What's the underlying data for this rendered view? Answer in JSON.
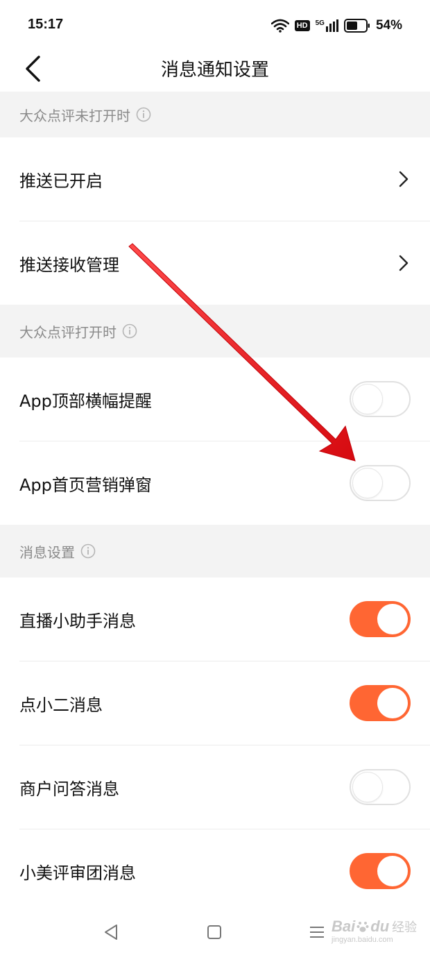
{
  "status_bar": {
    "time": "15:17",
    "network_badge": "HD",
    "network_type": "5G",
    "battery_percent": "54%"
  },
  "nav": {
    "title": "消息通知设置",
    "back_icon": "chevron-left-icon"
  },
  "sections": [
    {
      "header": "大众点评未打开时",
      "items": [
        {
          "label": "推送已开启",
          "control": "chevron"
        },
        {
          "label": "推送接收管理",
          "control": "chevron"
        }
      ]
    },
    {
      "header": "大众点评打开时",
      "items": [
        {
          "label": "App顶部横幅提醒",
          "control": "toggle",
          "enabled": false
        },
        {
          "label": "App首页营销弹窗",
          "control": "toggle",
          "enabled": false
        }
      ]
    },
    {
      "header": "消息设置",
      "items": [
        {
          "label": "直播小助手消息",
          "control": "toggle",
          "enabled": true
        },
        {
          "label": "点小二消息",
          "control": "toggle",
          "enabled": true
        },
        {
          "label": "商户问答消息",
          "control": "toggle",
          "enabled": false
        },
        {
          "label": "小美评审团消息",
          "control": "toggle",
          "enabled": true
        }
      ]
    }
  ],
  "watermark": {
    "brand": "Bai",
    "brand_suffix": "du",
    "label": "经验",
    "url": "jingyan.baidu.com"
  },
  "colors": {
    "accent": "#ff6633",
    "section_bg": "#f3f3f3",
    "annotation_arrow": "#e8141c"
  }
}
